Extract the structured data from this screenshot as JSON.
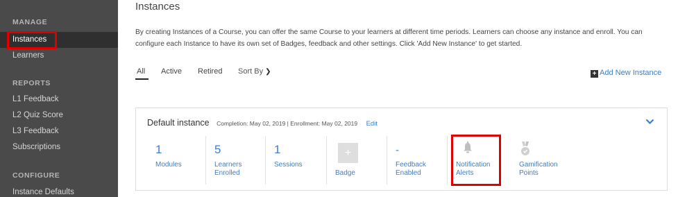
{
  "sidebar": {
    "sections": [
      {
        "title": "MANAGE",
        "items": [
          "Instances",
          "Learners"
        ]
      },
      {
        "title": "REPORTS",
        "items": [
          "L1 Feedback",
          "L2 Quiz Score",
          "L3 Feedback",
          "Subscriptions"
        ]
      },
      {
        "title": "CONFIGURE",
        "items": [
          "Instance Defaults"
        ]
      }
    ],
    "active_item": "Instances"
  },
  "main": {
    "title": "Instances",
    "description": "By creating Instances of a Course, you can offer the same Course to your learners at different time periods. Learners can choose any instance and enroll. You can configure each Instance to have its own set of Badges, feedback and other settings. Click 'Add New Instance' to get started.",
    "tabs": [
      "All",
      "Active",
      "Retired"
    ],
    "active_tab": "All",
    "sort_label": "Sort By",
    "add_new_label": "Add New Instance"
  },
  "instance": {
    "name": "Default instance",
    "meta": "Completion: May 02, 2019 | Enrollment: May 02, 2019",
    "edit_label": "Edit",
    "stats": [
      {
        "value": "1",
        "label_lines": [
          "Modules"
        ]
      },
      {
        "value": "5",
        "label_lines": [
          "Learners",
          "Enrolled"
        ]
      },
      {
        "value": "1",
        "label_lines": [
          "Sessions"
        ]
      },
      {
        "icon": "plus-icon",
        "label_lines": [
          "Badge"
        ]
      },
      {
        "value": "-",
        "label_lines": [
          "Feedback",
          "Enabled"
        ]
      },
      {
        "icon": "bell-icon",
        "label_lines": [
          "Notification",
          "Alerts"
        ]
      },
      {
        "icon": "medal-icon",
        "label_lines": [
          "Gamification",
          "Points"
        ]
      }
    ]
  },
  "colors": {
    "accent": "#3d7ec7",
    "highlight": "#e00000",
    "sidebar": "#4a4a4a"
  }
}
